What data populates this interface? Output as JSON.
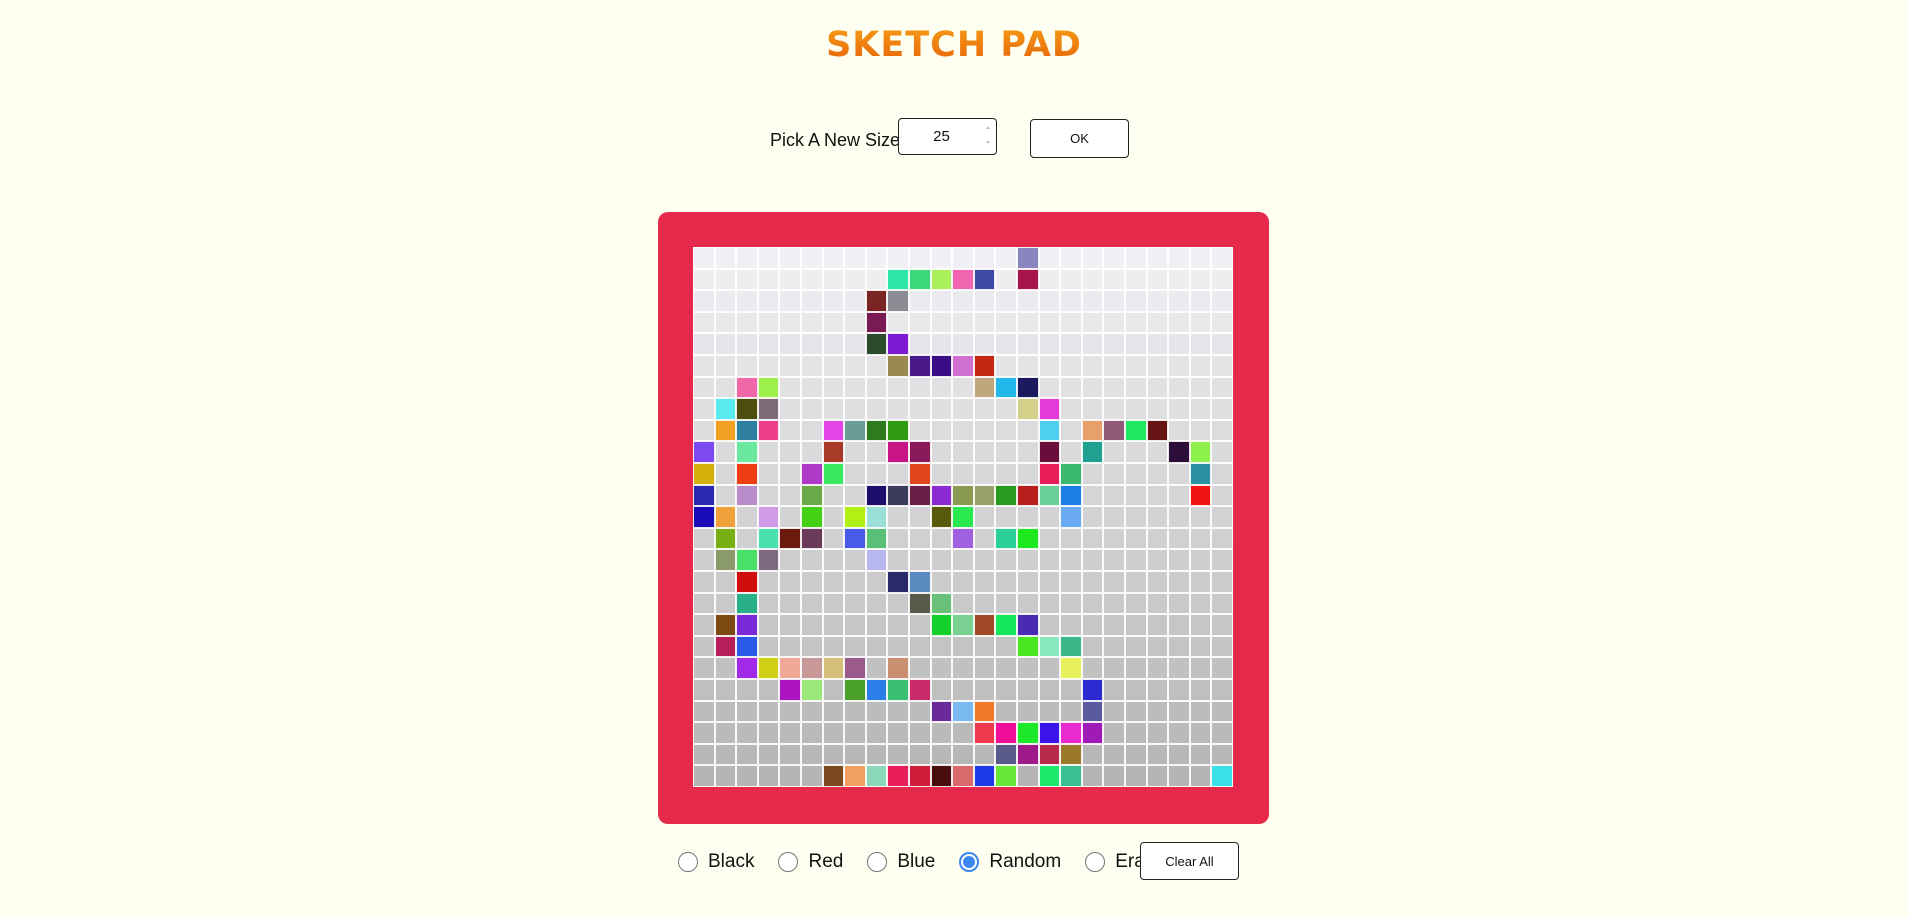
{
  "app": {
    "title": "SKETCH PAD"
  },
  "controls": {
    "size_label": "Pick A New Size",
    "size_value": "25",
    "ok_label": "OK",
    "clear_label": "Clear All"
  },
  "modes": [
    {
      "label": "Black",
      "checked": false
    },
    {
      "label": "Red",
      "checked": false
    },
    {
      "label": "Blue",
      "checked": false
    },
    {
      "label": "Random",
      "checked": true
    },
    {
      "label": "Erase",
      "checked": false
    }
  ],
  "board": {
    "frame_color": "#e4294b",
    "grid_size": 25,
    "background_top": "#f0eff3",
    "background_bottom": "#b5b5b5",
    "painted": [
      [
        0,
        15,
        "#8a85c0"
      ],
      [
        1,
        9,
        "#2ee6a8"
      ],
      [
        1,
        10,
        "#3cd77a"
      ],
      [
        1,
        11,
        "#a9f05c"
      ],
      [
        1,
        12,
        "#f064b0"
      ],
      [
        1,
        13,
        "#3f4aa6"
      ],
      [
        1,
        15,
        "#a8154a"
      ],
      [
        2,
        8,
        "#7b2424"
      ],
      [
        2,
        9,
        "#8b8b94"
      ],
      [
        3,
        8,
        "#7a1a55"
      ],
      [
        4,
        8,
        "#2c4a2c"
      ],
      [
        4,
        9,
        "#7d1bd4"
      ],
      [
        5,
        9,
        "#9b8a4f"
      ],
      [
        5,
        10,
        "#4a1a8a"
      ],
      [
        5,
        11,
        "#3a0d87"
      ],
      [
        5,
        12,
        "#d070d0"
      ],
      [
        5,
        13,
        "#c42713"
      ],
      [
        6,
        2,
        "#f068a8"
      ],
      [
        6,
        3,
        "#9df04a"
      ],
      [
        6,
        13,
        "#bfa77d"
      ],
      [
        6,
        14,
        "#22b8ea"
      ],
      [
        6,
        15,
        "#1a1a5c"
      ],
      [
        7,
        1,
        "#58ecf0"
      ],
      [
        7,
        2,
        "#4d4d0d"
      ],
      [
        7,
        3,
        "#7d6b78"
      ],
      [
        7,
        15,
        "#d4d08a"
      ],
      [
        7,
        16,
        "#e43ad8"
      ],
      [
        8,
        1,
        "#f2a022"
      ],
      [
        8,
        2,
        "#2f7fa0"
      ],
      [
        8,
        3,
        "#ee3f8a"
      ],
      [
        8,
        6,
        "#e344e8"
      ],
      [
        8,
        7,
        "#6b9c95"
      ],
      [
        8,
        8,
        "#2e7a1e"
      ],
      [
        8,
        9,
        "#2e9b12"
      ],
      [
        8,
        16,
        "#4ecff0"
      ],
      [
        8,
        18,
        "#e8a06b"
      ],
      [
        8,
        19,
        "#8e5a78"
      ],
      [
        8,
        20,
        "#1ee860"
      ],
      [
        8,
        21,
        "#671414"
      ],
      [
        9,
        0,
        "#7d4af0"
      ],
      [
        9,
        2,
        "#6ae8a0"
      ],
      [
        9,
        6,
        "#a83a28"
      ],
      [
        9,
        9,
        "#c81485"
      ],
      [
        9,
        10,
        "#8a1a5a"
      ],
      [
        9,
        16,
        "#6a0d3a"
      ],
      [
        9,
        18,
        "#1fa090"
      ],
      [
        9,
        22,
        "#2d0d3a"
      ],
      [
        9,
        23,
        "#8ef04a"
      ],
      [
        10,
        0,
        "#d4b00d"
      ],
      [
        10,
        2,
        "#ee3f14"
      ],
      [
        10,
        5,
        "#b03ac8"
      ],
      [
        10,
        6,
        "#3ae860"
      ],
      [
        10,
        10,
        "#e0451e"
      ],
      [
        10,
        16,
        "#e81e5a"
      ],
      [
        10,
        17,
        "#3ab870"
      ],
      [
        10,
        23,
        "#2a8fa0"
      ],
      [
        11,
        0,
        "#2a2ab0"
      ],
      [
        11,
        2,
        "#b88cc8"
      ],
      [
        11,
        5,
        "#6aa848"
      ],
      [
        11,
        8,
        "#1e0d6b"
      ],
      [
        11,
        9,
        "#3a3a5a"
      ],
      [
        11,
        10,
        "#6b1e4a"
      ],
      [
        11,
        11,
        "#8a2ad0"
      ],
      [
        11,
        12,
        "#8a9a50"
      ],
      [
        11,
        13,
        "#9aa06a"
      ],
      [
        11,
        14,
        "#2a9a1e"
      ],
      [
        11,
        15,
        "#b81e1e"
      ],
      [
        11,
        16,
        "#6ad098"
      ],
      [
        11,
        17,
        "#1e7ee8"
      ],
      [
        11,
        23,
        "#f01414"
      ],
      [
        12,
        0,
        "#1a0db8"
      ],
      [
        12,
        1,
        "#f0a03a"
      ],
      [
        12,
        3,
        "#d09ae8"
      ],
      [
        12,
        5,
        "#44d014"
      ],
      [
        12,
        7,
        "#b0f014"
      ],
      [
        12,
        8,
        "#9ae0d8"
      ],
      [
        12,
        11,
        "#5a5a0d"
      ],
      [
        12,
        12,
        "#2ae850"
      ],
      [
        12,
        17,
        "#6aaaf0"
      ],
      [
        13,
        1,
        "#78b014"
      ],
      [
        13,
        3,
        "#4ae0b0"
      ],
      [
        13,
        4,
        "#6b1a0d"
      ],
      [
        13,
        5,
        "#6b3a5a"
      ],
      [
        13,
        7,
        "#4a5ae8"
      ],
      [
        13,
        8,
        "#5ac078"
      ],
      [
        13,
        12,
        "#a060e0"
      ],
      [
        13,
        14,
        "#2ad098"
      ],
      [
        13,
        15,
        "#1ee81e"
      ],
      [
        14,
        1,
        "#8a9a6a"
      ],
      [
        14,
        2,
        "#4ae068"
      ],
      [
        14,
        3,
        "#7d6a80"
      ],
      [
        14,
        8,
        "#b8b8f0"
      ],
      [
        15,
        2,
        "#d00d0d"
      ],
      [
        15,
        9,
        "#2a2a6a"
      ],
      [
        15,
        10,
        "#5a8ac0"
      ],
      [
        16,
        2,
        "#2ab088"
      ],
      [
        16,
        10,
        "#5a5a4a"
      ],
      [
        16,
        11,
        "#6ac078"
      ],
      [
        17,
        1,
        "#7d4a14"
      ],
      [
        17,
        2,
        "#7a2ad8"
      ],
      [
        17,
        11,
        "#14d02a"
      ],
      [
        17,
        12,
        "#7ad090"
      ],
      [
        17,
        13,
        "#a04a2a"
      ],
      [
        17,
        14,
        "#14e85a"
      ],
      [
        17,
        15,
        "#4a2ab0"
      ],
      [
        18,
        1,
        "#b81e5a"
      ],
      [
        18,
        2,
        "#2a5ae8"
      ],
      [
        18,
        15,
        "#4ae81e"
      ],
      [
        18,
        16,
        "#8ae8c0"
      ],
      [
        18,
        17,
        "#3ab88a"
      ],
      [
        19,
        2,
        "#a02ae8"
      ],
      [
        19,
        3,
        "#d0d014"
      ],
      [
        19,
        4,
        "#f0a898"
      ],
      [
        19,
        5,
        "#c89898"
      ],
      [
        19,
        6,
        "#d4c078"
      ],
      [
        19,
        7,
        "#9a5a8a"
      ],
      [
        19,
        9,
        "#c89070"
      ],
      [
        19,
        17,
        "#e8f05a"
      ],
      [
        20,
        4,
        "#b014c0"
      ],
      [
        20,
        5,
        "#9ae878"
      ],
      [
        20,
        7,
        "#4aa02a"
      ],
      [
        20,
        8,
        "#2a7ee8"
      ],
      [
        20,
        9,
        "#3ac070"
      ],
      [
        20,
        10,
        "#c82a6a"
      ],
      [
        20,
        18,
        "#2a2ad0"
      ],
      [
        21,
        11,
        "#6a2a98"
      ],
      [
        21,
        12,
        "#7ab8f0"
      ],
      [
        21,
        13,
        "#f07a2a"
      ],
      [
        21,
        18,
        "#5a5aa0"
      ],
      [
        22,
        13,
        "#ee3a4a"
      ],
      [
        22,
        14,
        "#f00d98"
      ],
      [
        22,
        15,
        "#1ee82a"
      ],
      [
        22,
        16,
        "#3a14e8"
      ],
      [
        22,
        17,
        "#e82ad0"
      ],
      [
        22,
        18,
        "#a01ab8"
      ],
      [
        23,
        14,
        "#5a5a8a"
      ],
      [
        23,
        15,
        "#a01a8a"
      ],
      [
        23,
        16,
        "#b82a4a"
      ],
      [
        23,
        17,
        "#9a7a2a"
      ],
      [
        24,
        6,
        "#7a4a1e"
      ],
      [
        24,
        7,
        "#f0a060"
      ],
      [
        24,
        8,
        "#8ad8b8"
      ],
      [
        24,
        9,
        "#e81e5a"
      ],
      [
        24,
        10,
        "#d01e3a"
      ],
      [
        24,
        11,
        "#4a0d0d"
      ],
      [
        24,
        12,
        "#d86a6a"
      ],
      [
        24,
        13,
        "#1e3ae8"
      ],
      [
        24,
        14,
        "#6ae83a"
      ],
      [
        24,
        16,
        "#1ee86a"
      ],
      [
        24,
        17,
        "#3ac090"
      ],
      [
        24,
        24,
        "#3ae0e8"
      ]
    ]
  }
}
